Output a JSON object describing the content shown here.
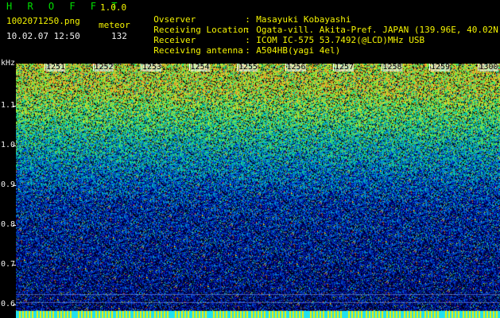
{
  "header": {
    "app_title": "H R O F F T",
    "app_version": "1.0.0",
    "file_name": "1002071250.png",
    "mode": "meteor",
    "datetime": "10.02.07 12:50",
    "count": "132"
  },
  "info": [
    {
      "label": "Ovserver",
      "value": "Masayuki Kobayashi"
    },
    {
      "label": "Receiving Location",
      "value": "Ogata-vill. Akita-Pref. JAPAN (139.96E, 40.02N)"
    },
    {
      "label": "Receiver",
      "value": "ICOM IC-575 53.7492(@LCD)MHz USB"
    },
    {
      "label": "Receiving antenna",
      "value": "A504HB(yagi 4el)"
    }
  ],
  "plot": {
    "y_unit": "kHz",
    "y_ticks": [
      "1.1",
      "1.0",
      "0.9",
      "0.8",
      "0.7",
      "0.6"
    ],
    "x_ticks": [
      "1251",
      "1252",
      "1253",
      "1254",
      "1255",
      "1256",
      "1257",
      "1258",
      "1259",
      "1300"
    ],
    "colors": {
      "background": "#000000",
      "text_yellow": "#f4f400",
      "text_green": "#00e000"
    }
  }
}
